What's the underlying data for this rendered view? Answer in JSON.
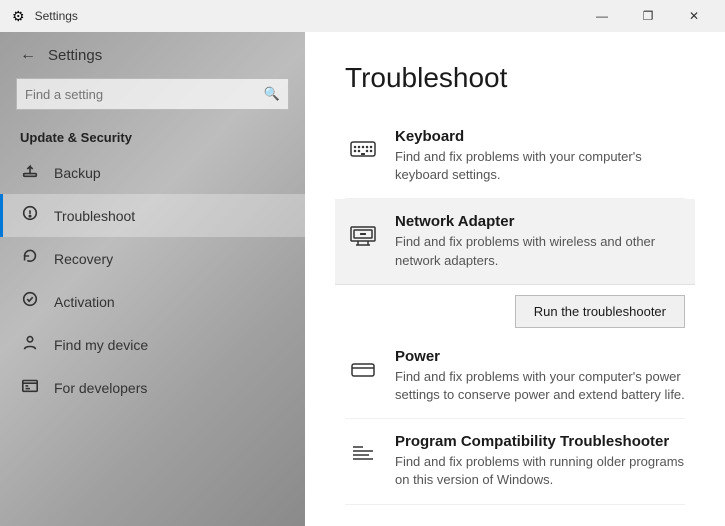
{
  "titlebar": {
    "title": "Settings",
    "minimize_label": "—",
    "maximize_label": "❐",
    "close_label": "✕",
    "back_icon": "←"
  },
  "sidebar": {
    "app_title": "Settings",
    "search_placeholder": "Find a setting",
    "section_title": "Update & Security",
    "items": [
      {
        "id": "backup",
        "label": "Backup",
        "icon": "↑"
      },
      {
        "id": "troubleshoot",
        "label": "Troubleshoot",
        "icon": "🔧"
      },
      {
        "id": "recovery",
        "label": "Recovery",
        "icon": "↺"
      },
      {
        "id": "activation",
        "label": "Activation",
        "icon": "✓"
      },
      {
        "id": "find-my-device",
        "label": "Find my device",
        "icon": "👤"
      },
      {
        "id": "for-developers",
        "label": "For developers",
        "icon": "⚙"
      }
    ]
  },
  "content": {
    "title": "Troubleshoot",
    "items": [
      {
        "id": "keyboard",
        "name": "Keyboard",
        "desc": "Find and fix problems with your computer's keyboard settings.",
        "highlighted": false
      },
      {
        "id": "network-adapter",
        "name": "Network Adapter",
        "desc": "Find and fix problems with wireless and other network adapters.",
        "highlighted": true
      },
      {
        "id": "power",
        "name": "Power",
        "desc": "Find and fix problems with your computer's power settings to conserve power and extend battery life.",
        "highlighted": false
      },
      {
        "id": "program-compatibility",
        "name": "Program Compatibility Troubleshooter",
        "desc": "Find and fix problems with running older programs on this version of Windows.",
        "highlighted": false
      }
    ],
    "run_button_label": "Run the troubleshooter"
  }
}
